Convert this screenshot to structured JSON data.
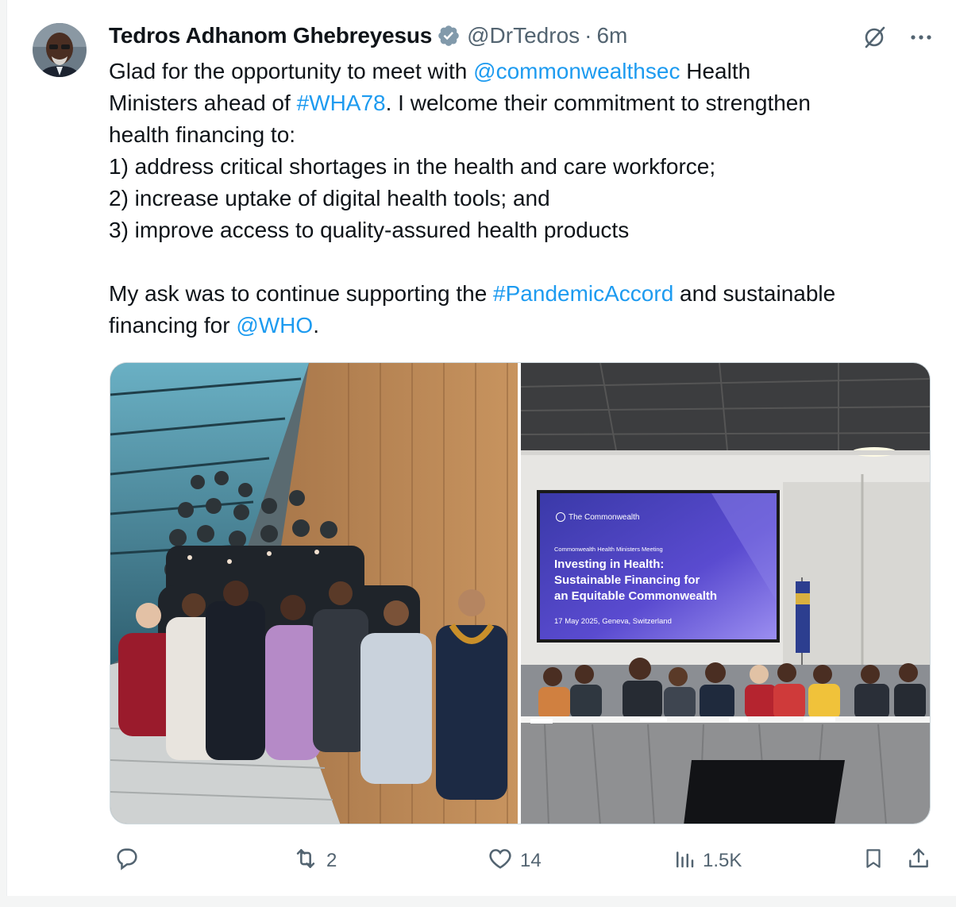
{
  "tweet": {
    "author_name": "Tedros Adhanom Ghebreyesus",
    "handle": "@DrTedros",
    "separator": "·",
    "time": "6m",
    "text_parts": [
      {
        "t": "Glad for the opportunity to meet with ",
        "link": false
      },
      {
        "t": "@commonwealthsec",
        "link": true
      },
      {
        "t": " Health\nMinisters ahead of ",
        "link": false
      },
      {
        "t": "#WHA78",
        "link": true
      },
      {
        "t": ". I welcome their commitment to strengthen\nhealth financing to:\n1) address critical shortages in the health and care workforce;\n2) increase uptake of digital health tools; and\n3) improve access to quality-assured health products\n\nMy ask was to continue supporting the ",
        "link": false
      },
      {
        "t": "#PandemicAccord",
        "link": true
      },
      {
        "t": " and sustainable\nfinancing for ",
        "link": false
      },
      {
        "t": "@WHO",
        "link": true
      },
      {
        "t": ".",
        "link": false
      }
    ]
  },
  "slide": {
    "org": "The Commonwealth",
    "meeting": "Commonwealth Health Ministers Meeting",
    "title_line1": "Investing in Health:",
    "title_line2": "Sustainable Financing for",
    "title_line3": "an Equitable Commonwealth",
    "date": "17 May 2025, Geneva, Switzerland"
  },
  "actions": {
    "reply_count": "",
    "retweet_count": "2",
    "like_count": "14",
    "views_count": "1.5K"
  },
  "colors": {
    "link": "#1d9bf0",
    "text": "#0f1419",
    "muted": "#536471",
    "verified": "#829aab"
  },
  "icons": [
    "verified-badge-icon",
    "grok-icon",
    "more-icon",
    "reply-icon",
    "retweet-icon",
    "like-icon",
    "views-icon",
    "bookmark-icon",
    "share-icon"
  ]
}
